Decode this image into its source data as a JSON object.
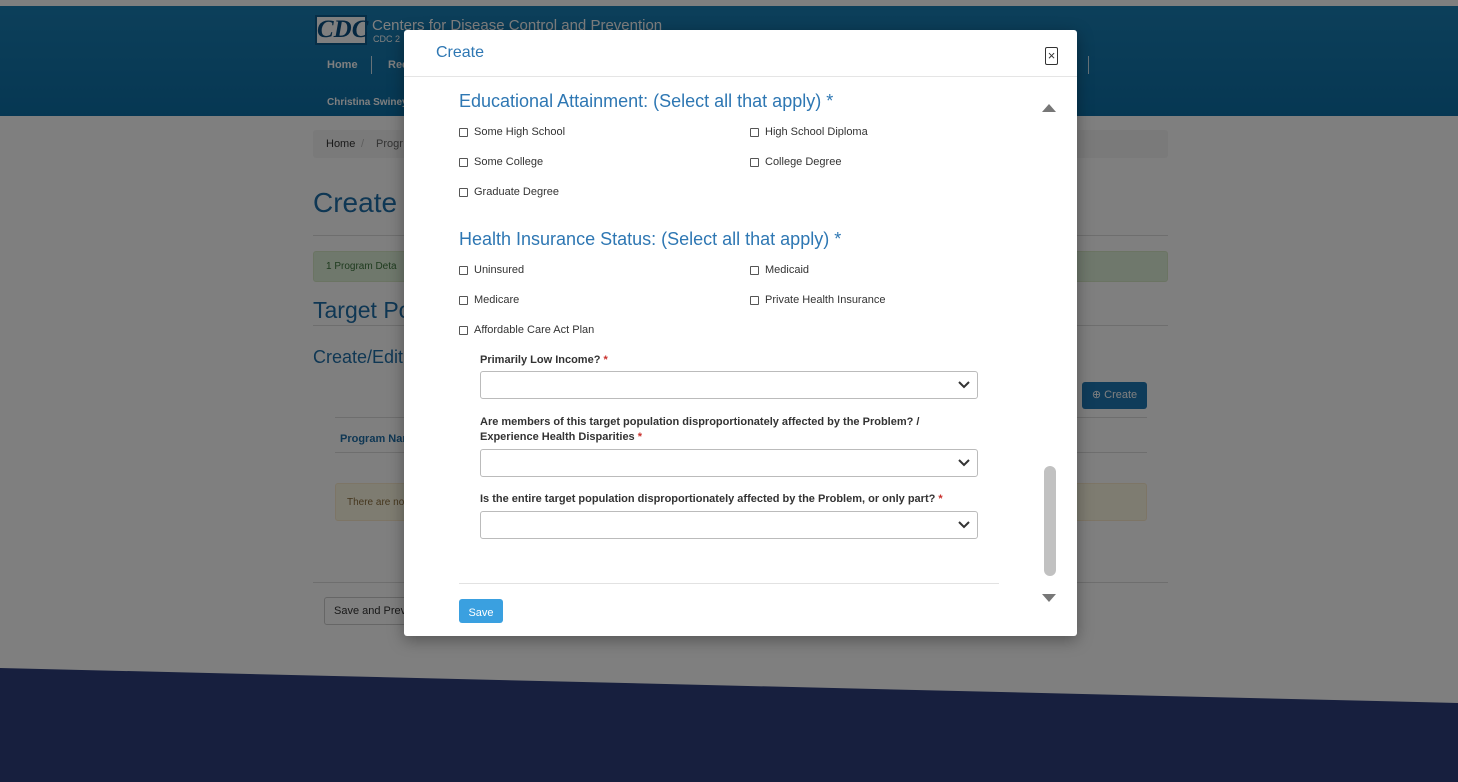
{
  "site": {
    "logo": "CDC",
    "title": "Centers for Disease Control and Prevention",
    "subtitle": "CDC 2",
    "nav_home": "Home",
    "nav_partial": "Rec",
    "user": "Christina Swiney"
  },
  "breadcrumb": {
    "home": "Home",
    "separator": "/",
    "current": "Progr"
  },
  "page": {
    "title": "Create",
    "step_label": "1  Program Deta",
    "section_title": "Target Po",
    "sub_title": "Create/Edit",
    "create_button": "Create",
    "table_column": "Program Nar",
    "empty_text": "There are no",
    "save_prev_button": "Save and Prev"
  },
  "modal": {
    "title": "Create",
    "close_icon": "×",
    "education": {
      "heading": "Educational Attainment: (Select all that apply) *",
      "options": [
        "Some High School",
        "High School Diploma",
        "Some College",
        "College Degree",
        "Graduate Degree"
      ]
    },
    "insurance": {
      "heading": "Health Insurance Status: (Select all that apply) *",
      "options": [
        "Uninsured",
        "Medicaid",
        "Medicare",
        "Private Health Insurance",
        "Affordable Care Act Plan"
      ]
    },
    "fields": {
      "low_income": "Primarily Low Income?",
      "disparities": "Are members of this target population disproportionately affected by the Problem? / Experience Health Disparities",
      "entire": "Is the entire target population disproportionately affected by the Problem, or only part?",
      "required_mark": "*"
    },
    "save_button": "Save"
  },
  "colors": {
    "header": "#0c6fa6",
    "accent": "#2e77b3",
    "footer": "#2e3f7c",
    "save": "#3aa0e0"
  }
}
